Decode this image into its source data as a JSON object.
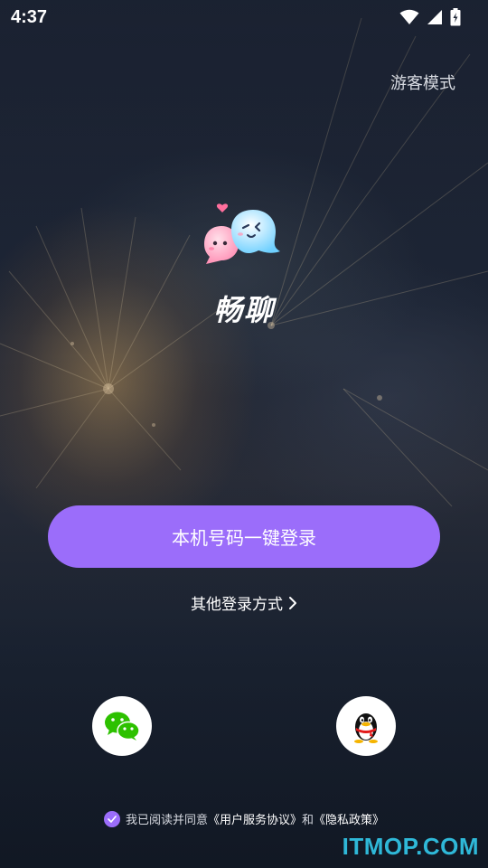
{
  "status_bar": {
    "time": "4:37",
    "icons": [
      "wifi-icon",
      "signal-icon",
      "battery-charging-icon"
    ]
  },
  "header": {
    "guest_mode": "游客模式"
  },
  "brand": {
    "app_name": "畅聊",
    "logo_icon": "ghost-chat-logo"
  },
  "login": {
    "one_click_label": "本机号码一键登录",
    "other_methods_label": "其他登录方式",
    "other_methods_icon": "chevron-right-icon"
  },
  "social": [
    {
      "name": "wechat",
      "icon": "wechat-icon"
    },
    {
      "name": "qq",
      "icon": "qq-penguin-icon"
    }
  ],
  "agreement": {
    "prefix": "我已阅读并同意",
    "user_agreement": "《用户服务协议》",
    "conjunction": "和",
    "privacy_policy": "《隐私政策》",
    "checked": true
  },
  "watermark": "ITMOP.COM",
  "colors": {
    "accent": "#9b6dfa",
    "watermark": "#2fb8d8"
  }
}
